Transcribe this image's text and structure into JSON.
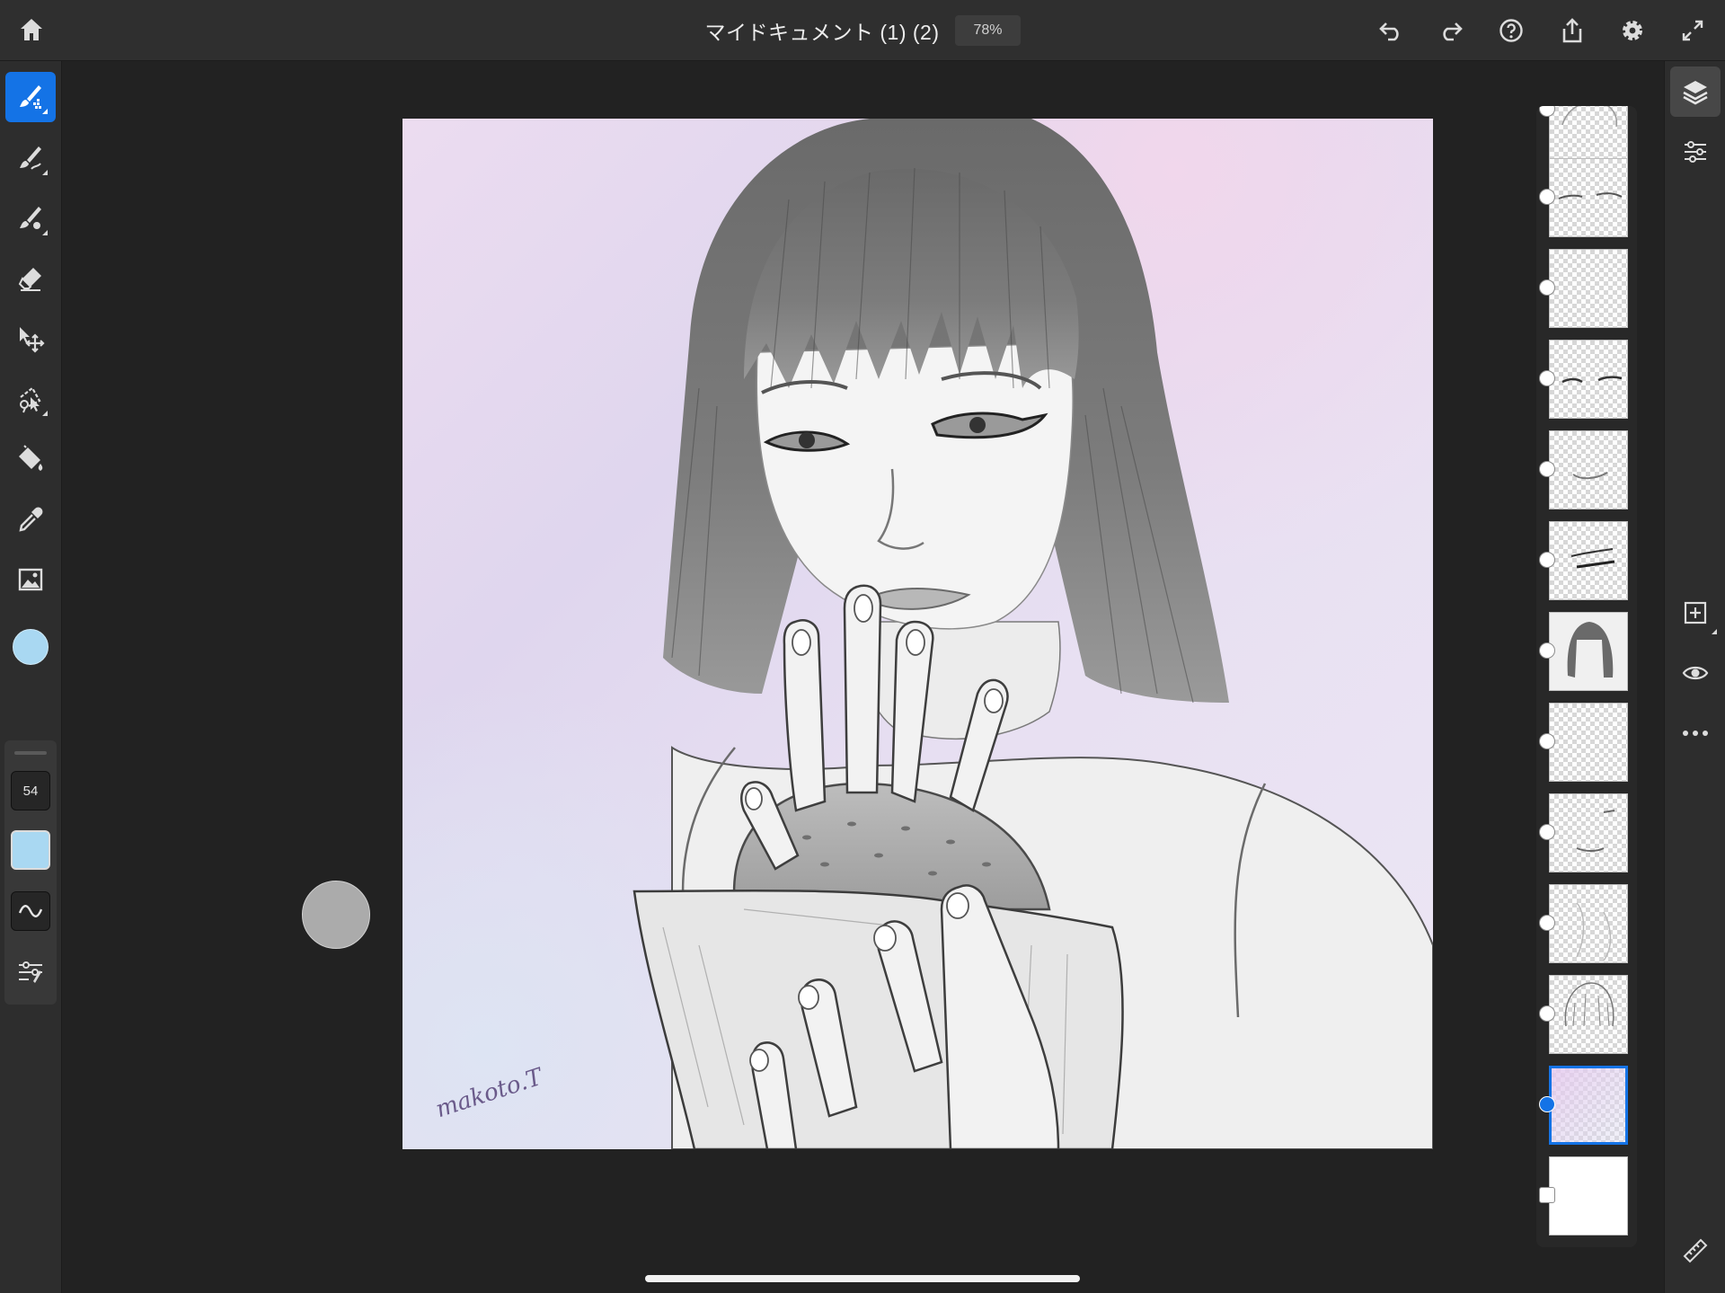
{
  "document": {
    "title": "マイドキュメント (1) (2)",
    "zoom": "78%"
  },
  "top_actions": [
    "home-icon",
    "undo-icon",
    "redo-icon",
    "help-icon",
    "share-icon",
    "settings-icon",
    "fullscreen-icon"
  ],
  "tools": [
    {
      "name": "pixel-brush-tool",
      "active": true
    },
    {
      "name": "live-brush-tool",
      "active": false
    },
    {
      "name": "vector-brush-tool",
      "active": false
    },
    {
      "name": "eraser-tool",
      "active": false
    },
    {
      "name": "transform-tool",
      "active": false
    },
    {
      "name": "selection-tool",
      "active": false
    },
    {
      "name": "fill-tool",
      "active": false
    },
    {
      "name": "eyedropper-tool",
      "active": false
    },
    {
      "name": "image-tool",
      "active": false
    }
  ],
  "brush": {
    "color": "#a9d8f2",
    "size": "54",
    "opacity_color": "#a9d8f2"
  },
  "accent_color": "#1473e6",
  "artwork": {
    "signature": "makoto.T"
  },
  "layers": {
    "count": 13,
    "selected_index": 11
  },
  "right_tools": [
    "layers-icon",
    "layer-properties-icon",
    "add-layer-icon",
    "visibility-icon",
    "more-icon",
    "ruler-icon"
  ]
}
